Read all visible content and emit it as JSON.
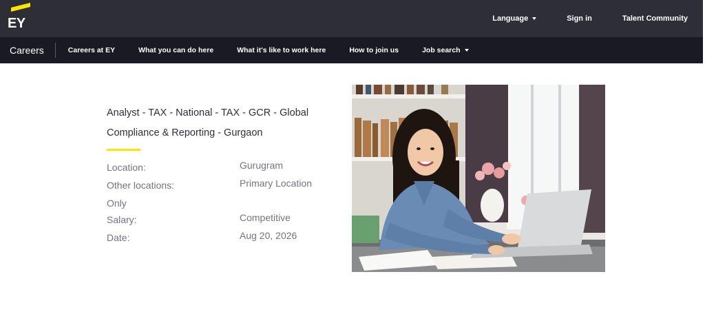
{
  "header": {
    "logo_text": "EY",
    "links": [
      {
        "label": "Language"
      },
      {
        "label": "Sign in"
      },
      {
        "label": "Talent Community"
      }
    ]
  },
  "nav": {
    "brand": "Careers",
    "items": [
      {
        "label": "Careers at EY"
      },
      {
        "label": "What you can do here"
      },
      {
        "label": "What it's like to work here"
      },
      {
        "label": "How to join us"
      },
      {
        "label": "Job search"
      }
    ]
  },
  "job": {
    "title_line1": "Analyst - TAX - National - TAX - GCR - Global",
    "title_line2": "Compliance & Reporting - Gurgaon",
    "details": {
      "location_label": "Location:",
      "location_value": "Gurugram",
      "other_label": "Other locations:",
      "other_value": "Primary Location",
      "other_value_cont": "Only",
      "salary_label": "Salary:",
      "salary_value": "Competitive",
      "date_label": "Date:",
      "date_value": "Aug 20, 2026"
    }
  },
  "colors": {
    "brand_yellow": "#ffe600",
    "header_bg": "#2e2e38",
    "nav_bg": "#1a1a24"
  }
}
